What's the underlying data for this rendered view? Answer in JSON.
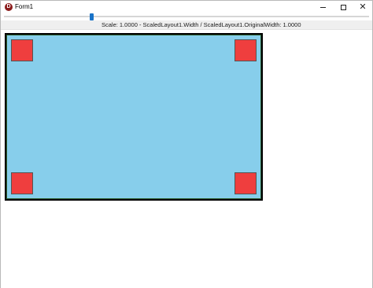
{
  "window": {
    "title": "Form1",
    "icon": "delphi-app-icon",
    "icon_glyph": "D",
    "controls": [
      "minimize-icon",
      "maximize-icon",
      "close-icon"
    ]
  },
  "trackbar": {
    "value_note": "thumb near left"
  },
  "status": {
    "text": "Scale: 1.0000 - ScaledLayout1.Width / ScaledLayout1.OriginalWidth:  1.0000"
  },
  "layout": {
    "background_color": "#87ceeb",
    "border_color": "#000000",
    "square_color": "#ef3e3e",
    "squares": [
      "top-left",
      "top-right",
      "bottom-left",
      "bottom-right"
    ]
  }
}
